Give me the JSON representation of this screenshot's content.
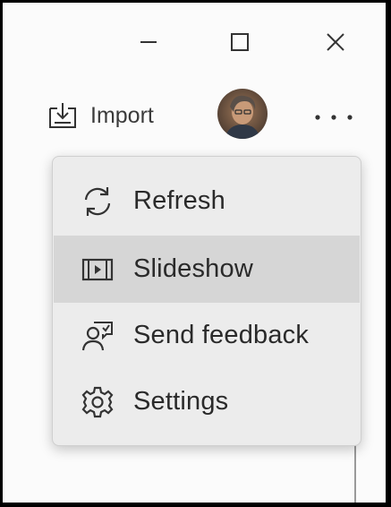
{
  "window": {
    "minimize_icon": "minimize-icon",
    "maximize_icon": "maximize-icon",
    "close_icon": "close-icon"
  },
  "toolbar": {
    "import_label": "Import",
    "import_icon": "import-icon",
    "more_icon": "more-horizontal-icon"
  },
  "menu": {
    "items": [
      {
        "label": "Refresh",
        "icon": "refresh-icon",
        "selected": false
      },
      {
        "label": "Slideshow",
        "icon": "slideshow-icon",
        "selected": true
      },
      {
        "label": "Send feedback",
        "icon": "feedback-icon",
        "selected": false
      },
      {
        "label": "Settings",
        "icon": "gear-icon",
        "selected": false
      }
    ]
  },
  "colors": {
    "menu_background": "#ececec",
    "selected_item": "#d6d6d6",
    "text": "#2a2a2a"
  }
}
